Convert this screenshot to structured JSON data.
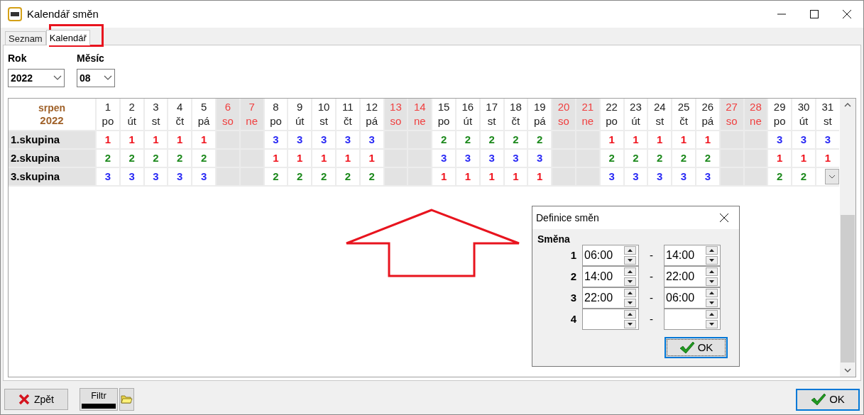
{
  "window": {
    "title": "Kalendář směn"
  },
  "tabs": [
    {
      "label": "Seznam",
      "selected": false
    },
    {
      "label": "Kalendář",
      "selected": true
    }
  ],
  "filters": [
    {
      "label": "Rok",
      "value": "2022"
    },
    {
      "label": "Měsíc",
      "value": "08"
    }
  ],
  "calendar": {
    "month": "srpen",
    "year": "2022",
    "days": [
      {
        "day": "1",
        "weekday": "po",
        "weekend": false
      },
      {
        "day": "2",
        "weekday": "út",
        "weekend": false
      },
      {
        "day": "3",
        "weekday": "st",
        "weekend": false
      },
      {
        "day": "4",
        "weekday": "čt",
        "weekend": false
      },
      {
        "day": "5",
        "weekday": "pá",
        "weekend": false
      },
      {
        "day": "6",
        "weekday": "so",
        "weekend": true
      },
      {
        "day": "7",
        "weekday": "ne",
        "weekend": true
      },
      {
        "day": "8",
        "weekday": "po",
        "weekend": false
      },
      {
        "day": "9",
        "weekday": "út",
        "weekend": false
      },
      {
        "day": "10",
        "weekday": "st",
        "weekend": false
      },
      {
        "day": "11",
        "weekday": "čt",
        "weekend": false
      },
      {
        "day": "12",
        "weekday": "pá",
        "weekend": false
      },
      {
        "day": "13",
        "weekday": "so",
        "weekend": true
      },
      {
        "day": "14",
        "weekday": "ne",
        "weekend": true
      },
      {
        "day": "15",
        "weekday": "po",
        "weekend": false
      },
      {
        "day": "16",
        "weekday": "út",
        "weekend": false
      },
      {
        "day": "17",
        "weekday": "st",
        "weekend": false
      },
      {
        "day": "18",
        "weekday": "čt",
        "weekend": false
      },
      {
        "day": "19",
        "weekday": "pá",
        "weekend": false
      },
      {
        "day": "20",
        "weekday": "so",
        "weekend": true
      },
      {
        "day": "21",
        "weekday": "ne",
        "weekend": true
      },
      {
        "day": "22",
        "weekday": "po",
        "weekend": false
      },
      {
        "day": "23",
        "weekday": "út",
        "weekend": false
      },
      {
        "day": "24",
        "weekday": "st",
        "weekend": false
      },
      {
        "day": "25",
        "weekday": "čt",
        "weekend": false
      },
      {
        "day": "26",
        "weekday": "pá",
        "weekend": false
      },
      {
        "day": "27",
        "weekday": "so",
        "weekend": true
      },
      {
        "day": "28",
        "weekday": "ne",
        "weekend": true
      },
      {
        "day": "29",
        "weekday": "po",
        "weekend": false
      },
      {
        "day": "30",
        "weekday": "út",
        "weekend": false
      },
      {
        "day": "31",
        "weekday": "st",
        "weekend": false
      }
    ],
    "groups": [
      {
        "name": "1.skupina",
        "cells": [
          {
            "kind": "shift",
            "value": "1",
            "color": "#f0141e"
          },
          {
            "kind": "shift",
            "value": "1",
            "color": "#f0141e"
          },
          {
            "kind": "shift",
            "value": "1",
            "color": "#f0141e"
          },
          {
            "kind": "shift",
            "value": "1",
            "color": "#f0141e"
          },
          {
            "kind": "shift",
            "value": "1",
            "color": "#f0141e"
          },
          {
            "kind": "off"
          },
          {
            "kind": "off"
          },
          {
            "kind": "shift",
            "value": "3",
            "color": "#2a2af5"
          },
          {
            "kind": "shift",
            "value": "3",
            "color": "#2a2af5"
          },
          {
            "kind": "shift",
            "value": "3",
            "color": "#2a2af5"
          },
          {
            "kind": "shift",
            "value": "3",
            "color": "#2a2af5"
          },
          {
            "kind": "shift",
            "value": "3",
            "color": "#2a2af5"
          },
          {
            "kind": "off"
          },
          {
            "kind": "off"
          },
          {
            "kind": "shift",
            "value": "2",
            "color": "#1e8a1e"
          },
          {
            "kind": "shift",
            "value": "2",
            "color": "#1e8a1e"
          },
          {
            "kind": "shift",
            "value": "2",
            "color": "#1e8a1e"
          },
          {
            "kind": "shift",
            "value": "2",
            "color": "#1e8a1e"
          },
          {
            "kind": "shift",
            "value": "2",
            "color": "#1e8a1e"
          },
          {
            "kind": "off"
          },
          {
            "kind": "off"
          },
          {
            "kind": "shift",
            "value": "1",
            "color": "#f0141e"
          },
          {
            "kind": "shift",
            "value": "1",
            "color": "#f0141e"
          },
          {
            "kind": "shift",
            "value": "1",
            "color": "#f0141e"
          },
          {
            "kind": "shift",
            "value": "1",
            "color": "#f0141e"
          },
          {
            "kind": "shift",
            "value": "1",
            "color": "#f0141e"
          },
          {
            "kind": "off"
          },
          {
            "kind": "off"
          },
          {
            "kind": "shift",
            "value": "3",
            "color": "#2a2af5"
          },
          {
            "kind": "shift",
            "value": "3",
            "color": "#2a2af5"
          },
          {
            "kind": "shift",
            "value": "3",
            "color": "#2a2af5"
          }
        ]
      },
      {
        "name": "2.skupina",
        "cells": [
          {
            "kind": "shift",
            "value": "2",
            "color": "#1e8a1e"
          },
          {
            "kind": "shift",
            "value": "2",
            "color": "#1e8a1e"
          },
          {
            "kind": "shift",
            "value": "2",
            "color": "#1e8a1e"
          },
          {
            "kind": "shift",
            "value": "2",
            "color": "#1e8a1e"
          },
          {
            "kind": "shift",
            "value": "2",
            "color": "#1e8a1e"
          },
          {
            "kind": "off"
          },
          {
            "kind": "off"
          },
          {
            "kind": "shift",
            "value": "1",
            "color": "#f0141e"
          },
          {
            "kind": "shift",
            "value": "1",
            "color": "#f0141e"
          },
          {
            "kind": "shift",
            "value": "1",
            "color": "#f0141e"
          },
          {
            "kind": "shift",
            "value": "1",
            "color": "#f0141e"
          },
          {
            "kind": "shift",
            "value": "1",
            "color": "#f0141e"
          },
          {
            "kind": "off"
          },
          {
            "kind": "off"
          },
          {
            "kind": "shift",
            "value": "3",
            "color": "#2a2af5"
          },
          {
            "kind": "shift",
            "value": "3",
            "color": "#2a2af5"
          },
          {
            "kind": "shift",
            "value": "3",
            "color": "#2a2af5"
          },
          {
            "kind": "shift",
            "value": "3",
            "color": "#2a2af5"
          },
          {
            "kind": "shift",
            "value": "3",
            "color": "#2a2af5"
          },
          {
            "kind": "off"
          },
          {
            "kind": "off"
          },
          {
            "kind": "shift",
            "value": "2",
            "color": "#1e8a1e"
          },
          {
            "kind": "shift",
            "value": "2",
            "color": "#1e8a1e"
          },
          {
            "kind": "shift",
            "value": "2",
            "color": "#1e8a1e"
          },
          {
            "kind": "shift",
            "value": "2",
            "color": "#1e8a1e"
          },
          {
            "kind": "shift",
            "value": "2",
            "color": "#1e8a1e"
          },
          {
            "kind": "off"
          },
          {
            "kind": "off"
          },
          {
            "kind": "shift",
            "value": "1",
            "color": "#f0141e"
          },
          {
            "kind": "shift",
            "value": "1",
            "color": "#f0141e"
          },
          {
            "kind": "shift",
            "value": "1",
            "color": "#f0141e"
          }
        ]
      },
      {
        "name": "3.skupina",
        "cells": [
          {
            "kind": "shift",
            "value": "3",
            "color": "#2a2af5"
          },
          {
            "kind": "shift",
            "value": "3",
            "color": "#2a2af5"
          },
          {
            "kind": "shift",
            "value": "3",
            "color": "#2a2af5"
          },
          {
            "kind": "shift",
            "value": "3",
            "color": "#2a2af5"
          },
          {
            "kind": "shift",
            "value": "3",
            "color": "#2a2af5"
          },
          {
            "kind": "off"
          },
          {
            "kind": "off"
          },
          {
            "kind": "shift",
            "value": "2",
            "color": "#1e8a1e"
          },
          {
            "kind": "shift",
            "value": "2",
            "color": "#1e8a1e"
          },
          {
            "kind": "shift",
            "value": "2",
            "color": "#1e8a1e"
          },
          {
            "kind": "shift",
            "value": "2",
            "color": "#1e8a1e"
          },
          {
            "kind": "shift",
            "value": "2",
            "color": "#1e8a1e"
          },
          {
            "kind": "off"
          },
          {
            "kind": "off"
          },
          {
            "kind": "shift",
            "value": "1",
            "color": "#f0141e"
          },
          {
            "kind": "shift",
            "value": "1",
            "color": "#f0141e"
          },
          {
            "kind": "shift",
            "value": "1",
            "color": "#f0141e"
          },
          {
            "kind": "shift",
            "value": "1",
            "color": "#f0141e"
          },
          {
            "kind": "shift",
            "value": "1",
            "color": "#f0141e"
          },
          {
            "kind": "off"
          },
          {
            "kind": "off"
          },
          {
            "kind": "shift",
            "value": "3",
            "color": "#2a2af5"
          },
          {
            "kind": "shift",
            "value": "3",
            "color": "#2a2af5"
          },
          {
            "kind": "shift",
            "value": "3",
            "color": "#2a2af5"
          },
          {
            "kind": "shift",
            "value": "3",
            "color": "#2a2af5"
          },
          {
            "kind": "shift",
            "value": "3",
            "color": "#2a2af5"
          },
          {
            "kind": "off"
          },
          {
            "kind": "off"
          },
          {
            "kind": "shift",
            "value": "2",
            "color": "#1e8a1e"
          },
          {
            "kind": "shift",
            "value": "2",
            "color": "#1e8a1e"
          },
          {
            "kind": "dropdown"
          }
        ]
      }
    ]
  },
  "dialog": {
    "title": "Definice směn",
    "heading": "Směna",
    "shifts": [
      {
        "number": "1",
        "from": "06:00",
        "separator": "-",
        "to": "14:00"
      },
      {
        "number": "2",
        "from": "14:00",
        "separator": "-",
        "to": "22:00"
      },
      {
        "number": "3",
        "from": "22:00",
        "separator": "-",
        "to": "06:00"
      },
      {
        "number": "4",
        "separator": "-"
      }
    ],
    "ok": "OK"
  },
  "footer": {
    "back": "Zpět",
    "filter": "Filtr",
    "ok": "OK"
  }
}
